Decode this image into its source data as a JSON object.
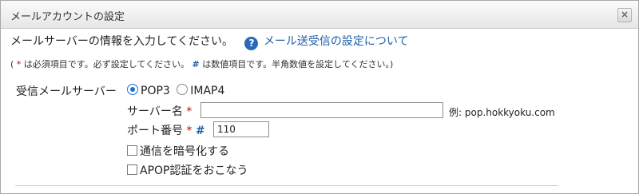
{
  "dialog": {
    "title": "メールアカウントの設定",
    "close_label": "×"
  },
  "intro": {
    "text": "メールサーバーの情報を入力してください。",
    "help_icon": "?",
    "help_link": "メール送受信の設定について"
  },
  "note": {
    "open": "(",
    "required_mark": "*",
    "required_text": " は必須項目です。必ず設定してください。",
    "numeric_mark": "#",
    "numeric_text": " は数値項目です。半角数値を設定してください。)"
  },
  "form": {
    "incoming_server_label": "受信メールサーバー",
    "protocol_options": [
      "POP3",
      "IMAP4"
    ],
    "selected_protocol": "POP3",
    "server_name": {
      "label": "サーバー名",
      "required_mark": "*",
      "value": "",
      "example": "例: pop.hokkyoku.com"
    },
    "port": {
      "label": "ポート番号",
      "required_mark": "*",
      "numeric_mark": "#",
      "value": "110"
    },
    "encrypt_label": "通信を暗号化する",
    "encrypt_checked": false,
    "apop_label": "APOP認証をおこなう",
    "apop_checked": false
  }
}
